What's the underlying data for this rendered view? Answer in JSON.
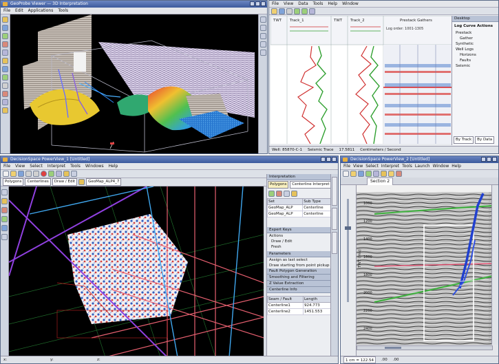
{
  "w1": {
    "title": "GeoProbe Viewer — 3D Interpretation",
    "menus": [
      "File",
      "Edit",
      "Applications",
      "Tools"
    ],
    "colors": {
      "canvas": "#000000",
      "horizon_warm": "#e8c830",
      "horizon_cool": "#30a870"
    }
  },
  "w2": {
    "menus": [
      "File",
      "View",
      "Data",
      "Tools",
      "Help",
      "Window"
    ],
    "tracks": [
      "TWT",
      "Track_1",
      "TWT",
      "Track_2",
      "Prestack Gathers"
    ],
    "gather_caption": "Log order: 1001-1305",
    "right_panel": {
      "header": "Desktop",
      "title": "Log Curve Actions",
      "items": [
        "Prestack",
        "Gather",
        "Synthetic",
        "Well Logs",
        "Horizons",
        "Faults",
        "Seismic"
      ],
      "by_track": "By Track",
      "by_data": "By Data"
    },
    "status": {
      "well": "Well: 85870-C-1",
      "type": "Seismic Trace",
      "value": "17.5811",
      "units": "Centimeters / Second"
    }
  },
  "w3": {
    "title": "DecisionSpace PowerView_1 [Untitled]",
    "menus": [
      "File",
      "View",
      "Select",
      "Interpret",
      "Tools",
      "Windows",
      "Help"
    ],
    "toolbar": {
      "mode": "Polygons",
      "type": "Centerlines",
      "action": "Draw / Edit",
      "layer": "GeoMap_ALP4_7"
    },
    "interp": {
      "header": "Interpretation",
      "tabs": [
        "Polygons",
        "Centerline Interpret"
      ],
      "set_col": "Set",
      "subtype_col": "Sub Type",
      "rows": [
        {
          "set": "GeoMap_ALP",
          "sub": "Centerline"
        },
        {
          "set": "GeoMap_ALP",
          "sub": "Centerline"
        }
      ],
      "sections": [
        "Expert Keys",
        "Actions",
        "Draw / Edit",
        "Fresh",
        "Parameters",
        "Assign as last select",
        "Draw starting from point pickup",
        "Fault Polygon Generation",
        "Smoothing and Filtering",
        "Z Value Extraction",
        "Centerline Info"
      ],
      "info_cols": [
        "Seam / Fault",
        "Length"
      ],
      "info_rows": [
        [
          "Centerline1",
          "924.773"
        ],
        [
          "Centerline2",
          "1451.553"
        ]
      ]
    },
    "status": [
      "x:",
      "y:",
      "z:"
    ]
  },
  "w4": {
    "title": "DecisionSpace PowerView_2 [Untitled]",
    "menus": [
      "File",
      "View",
      "Select",
      "Interpret",
      "Tools",
      "Launch",
      "Window",
      "Help"
    ],
    "section_label": "Section 2",
    "axis_label": "TWT (ms)",
    "y_ticks": [
      "1000",
      "1200",
      "1400",
      "1600",
      "1800",
      "2000",
      "2200",
      "2400"
    ],
    "status": {
      "scale": "1 cm = 122.54",
      "x": ".00",
      "y": ".00"
    }
  }
}
